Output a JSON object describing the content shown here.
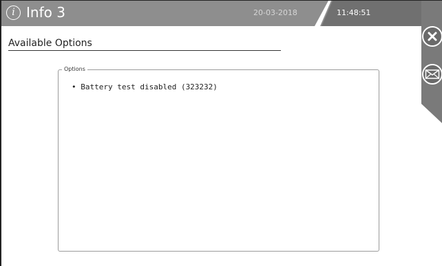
{
  "header": {
    "info_icon_glyph": "i",
    "title": "Info 3",
    "date": "20-03-2018",
    "time": "11:48:51"
  },
  "side_buttons": {
    "close_icon": "close-icon",
    "mail_icon": "mail-icon"
  },
  "section": {
    "title": "Available Options"
  },
  "options": {
    "legend": "Options",
    "items": [
      "• Battery test disabled (323232)"
    ]
  },
  "colors": {
    "header_bg": "#8e8e8e",
    "time_panel_bg": "#707070",
    "side_panel_bg": "#7a7a7a"
  }
}
